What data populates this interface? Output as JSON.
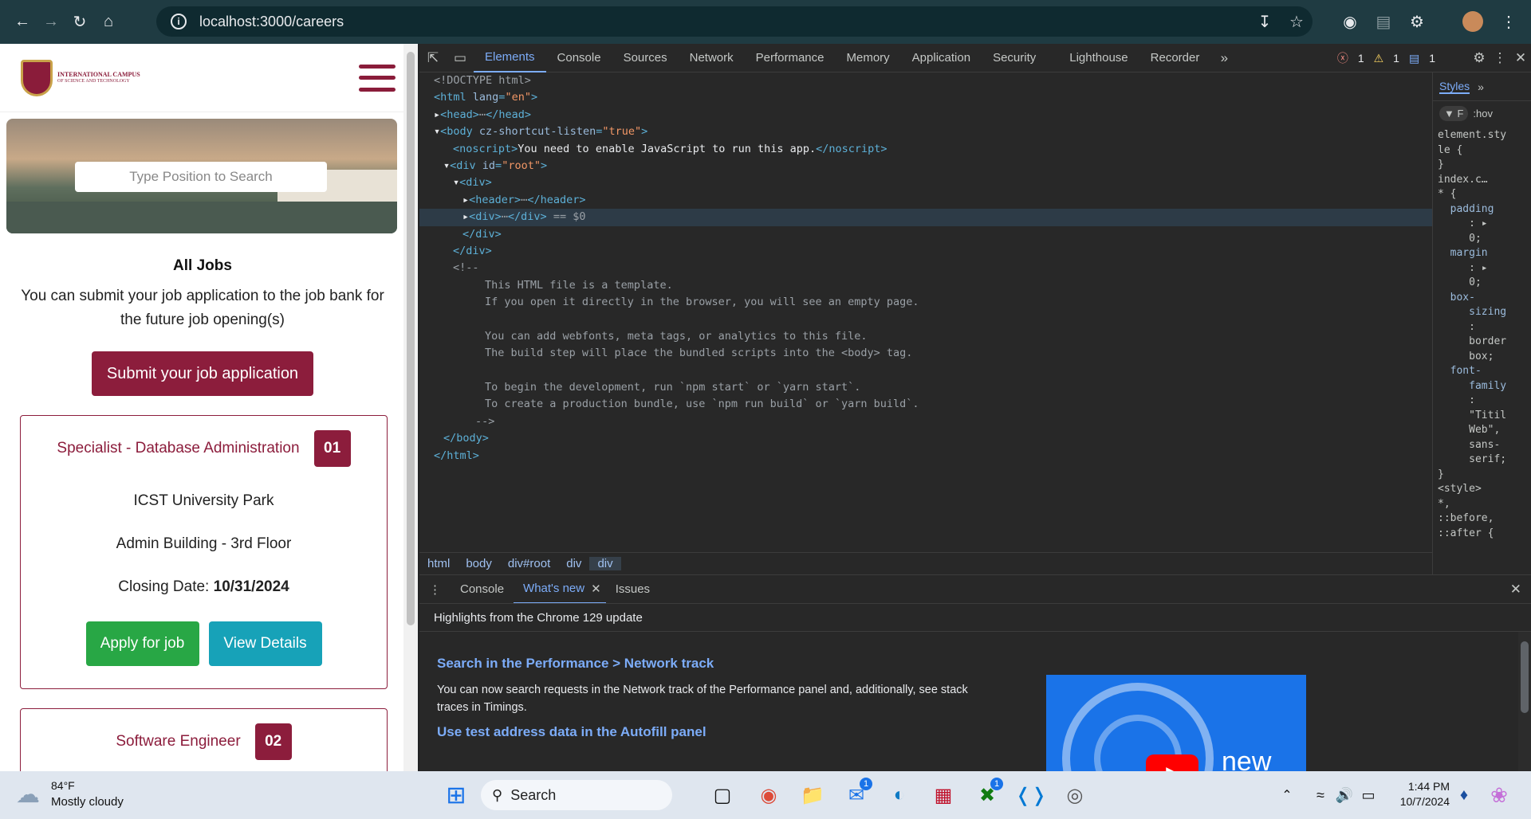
{
  "browser": {
    "url": "localhost:3000/careers"
  },
  "site": {
    "logo_line1": "INTERNATIONAL CAMPUS",
    "logo_line2": "OF SCIENCE AND TECHNOLOGY",
    "search_placeholder": "Type Position to Search",
    "section_title": "All Jobs",
    "section_desc": "You can submit your job application to the job bank for the future job opening(s)",
    "submit_label": "Submit your job application",
    "jobs": [
      {
        "title": "Specialist - Database Administration",
        "number": "01",
        "location": "ICST University Park",
        "building": "Admin Building - 3rd Floor",
        "closing_label": "Closing Date: ",
        "closing_date": "10/31/2024",
        "apply_label": "Apply for job",
        "details_label": "View Details"
      },
      {
        "title": "Software Engineer",
        "number": "02"
      }
    ]
  },
  "devtools": {
    "tabs": [
      "Elements",
      "Console",
      "Sources",
      "Network",
      "Performance",
      "Memory",
      "Application",
      "Security",
      "Lighthouse",
      "Recorder"
    ],
    "errors": "1",
    "warnings": "1",
    "messages": "1",
    "code": {
      "doctype": "<!DOCTYPE html>",
      "html_open_tag": "<html ",
      "html_attr": "lang",
      "html_val": "\"en\"",
      "head": "<head>",
      "head_close": "</head>",
      "body_open": "<body ",
      "body_attr": "cz-shortcut-listen",
      "body_val": "\"true\"",
      "noscript_open": "<noscript>",
      "noscript_text": "You need to enable JavaScript to run this app.",
      "noscript_close": "</noscript>",
      "div_root_open": "<div ",
      "div_root_attr": "id",
      "div_root_val": "\"root\"",
      "div_open": "<div>",
      "header_open": "<header>",
      "header_close": "</header>",
      "div_close": "</div>",
      "selected_marker": "== $0",
      "comment_open": "<!--",
      "comment_lines": [
        "This HTML file is a template.",
        "If you open it directly in the browser, you will see an empty page.",
        "",
        "You can add webfonts, meta tags, or analytics to this file.",
        "The build step will place the bundled scripts into the <body> tag.",
        "",
        "To begin the development, run `npm start` or `yarn start`.",
        "To create a production bundle, use `npm run build` or `yarn build`."
      ],
      "comment_close": "-->",
      "body_close": "</body>",
      "html_close": "</html>"
    },
    "breadcrumbs": [
      "html",
      "body",
      "div#root",
      "div",
      "div"
    ],
    "styles_tab": "Styles",
    "styles_filter": ":hov",
    "styles_lines": [
      "element.sty",
      "le {",
      "}",
      "index.c…",
      "* {",
      "padding",
      ": ▸",
      "0;",
      "margin",
      ": ▸",
      "0;",
      "box-",
      "sizing",
      ":",
      "border",
      "box;",
      "font-",
      "family",
      ":",
      "\"Titil",
      "Web\",",
      "sans-",
      "serif;",
      "}",
      "<style>",
      "*,",
      "::before,",
      "::after {"
    ],
    "drawer_tabs": [
      "Console",
      "What's new",
      "Issues"
    ],
    "whatsnew_header": "Highlights from the Chrome 129 update",
    "whatsnew_h1": "Search in the Performance > Network track",
    "whatsnew_p1": "You can now search requests in the Network track of the Performance panel and, additionally, see stack traces in Timings.",
    "whatsnew_h2": "Use test address data in the Autofill panel",
    "whatsnew_img_text": "new"
  },
  "taskbar": {
    "temp": "84°F",
    "weather": "Mostly cloudy",
    "search_label": "Search",
    "time": "1:44 PM",
    "date": "10/7/2024",
    "mail_badge": "1",
    "xbox_badge": "1"
  }
}
